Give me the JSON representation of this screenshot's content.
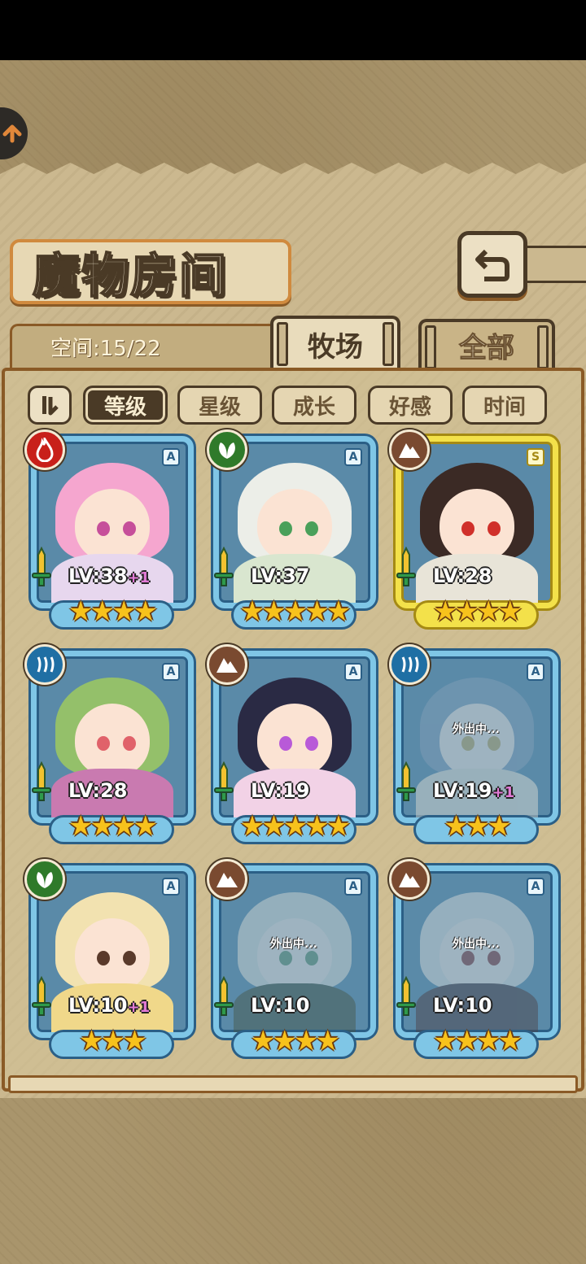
{
  "title": "魔物房间",
  "space_label": "空间:15/22",
  "tabs": [
    {
      "label": "牧场",
      "active": true
    },
    {
      "label": "全部",
      "active": false
    }
  ],
  "sort_buttons": [
    {
      "label": "等级",
      "active": true
    },
    {
      "label": "星级",
      "active": false
    },
    {
      "label": "成长",
      "active": false
    },
    {
      "label": "好感",
      "active": false
    },
    {
      "label": "时间",
      "active": false
    }
  ],
  "away_text": "外出中...",
  "monsters": [
    {
      "element": "fire",
      "rank": "A",
      "level": "LV:38",
      "bonus": "+1",
      "stars": "★★★★",
      "away": false,
      "frame": "blue",
      "hair": "#f5a6cf",
      "eyes": "#c64f9a",
      "outfit": "#e7d7ee"
    },
    {
      "element": "leaf",
      "rank": "A",
      "level": "LV:37",
      "bonus": "",
      "stars": "★★★★★",
      "away": false,
      "frame": "blue",
      "hair": "#eceee8",
      "eyes": "#4aa05a",
      "outfit": "#d9e6cf"
    },
    {
      "element": "earth",
      "rank": "S",
      "level": "LV:28",
      "bonus": "",
      "stars": "★★★★",
      "away": false,
      "frame": "gold",
      "hair": "#3b2a25",
      "eyes": "#d0302a",
      "outfit": "#e8e4d8"
    },
    {
      "element": "water",
      "rank": "A",
      "level": "LV:28",
      "bonus": "",
      "stars": "★★★★",
      "away": false,
      "frame": "blue",
      "hair": "#94c06a",
      "eyes": "#e0626a",
      "outfit": "#c97ab0"
    },
    {
      "element": "earth",
      "rank": "A",
      "level": "LV:19",
      "bonus": "",
      "stars": "★★★★★",
      "away": false,
      "frame": "blue",
      "hair": "#2a2a44",
      "eyes": "#b85ad8",
      "outfit": "#f2d2e6"
    },
    {
      "element": "water",
      "rank": "A",
      "level": "LV:19",
      "bonus": "+1",
      "stars": "★★★",
      "away": true,
      "frame": "blue",
      "hair": "#6fa3d4",
      "eyes": "#d8a82a",
      "outfit": "#e8e0c8"
    },
    {
      "element": "leaf",
      "rank": "A",
      "level": "LV:10",
      "bonus": "+1",
      "stars": "★★★",
      "away": false,
      "frame": "blue",
      "hair": "#f2e2b0",
      "eyes": "#5a3a2a",
      "outfit": "#f0d88a"
    },
    {
      "element": "earth",
      "rank": "A",
      "level": "LV:10",
      "bonus": "",
      "stars": "★★★★",
      "away": true,
      "frame": "blue",
      "hair": "#dcdcd0",
      "eyes": "#4aa05a",
      "outfit": "#3f5a3a"
    },
    {
      "element": "earth",
      "rank": "A",
      "level": "LV:10",
      "bonus": "",
      "stars": "★★★★",
      "away": true,
      "frame": "blue",
      "hair": "#e0dcd8",
      "eyes": "#c83030",
      "outfit": "#5a3a44"
    }
  ]
}
